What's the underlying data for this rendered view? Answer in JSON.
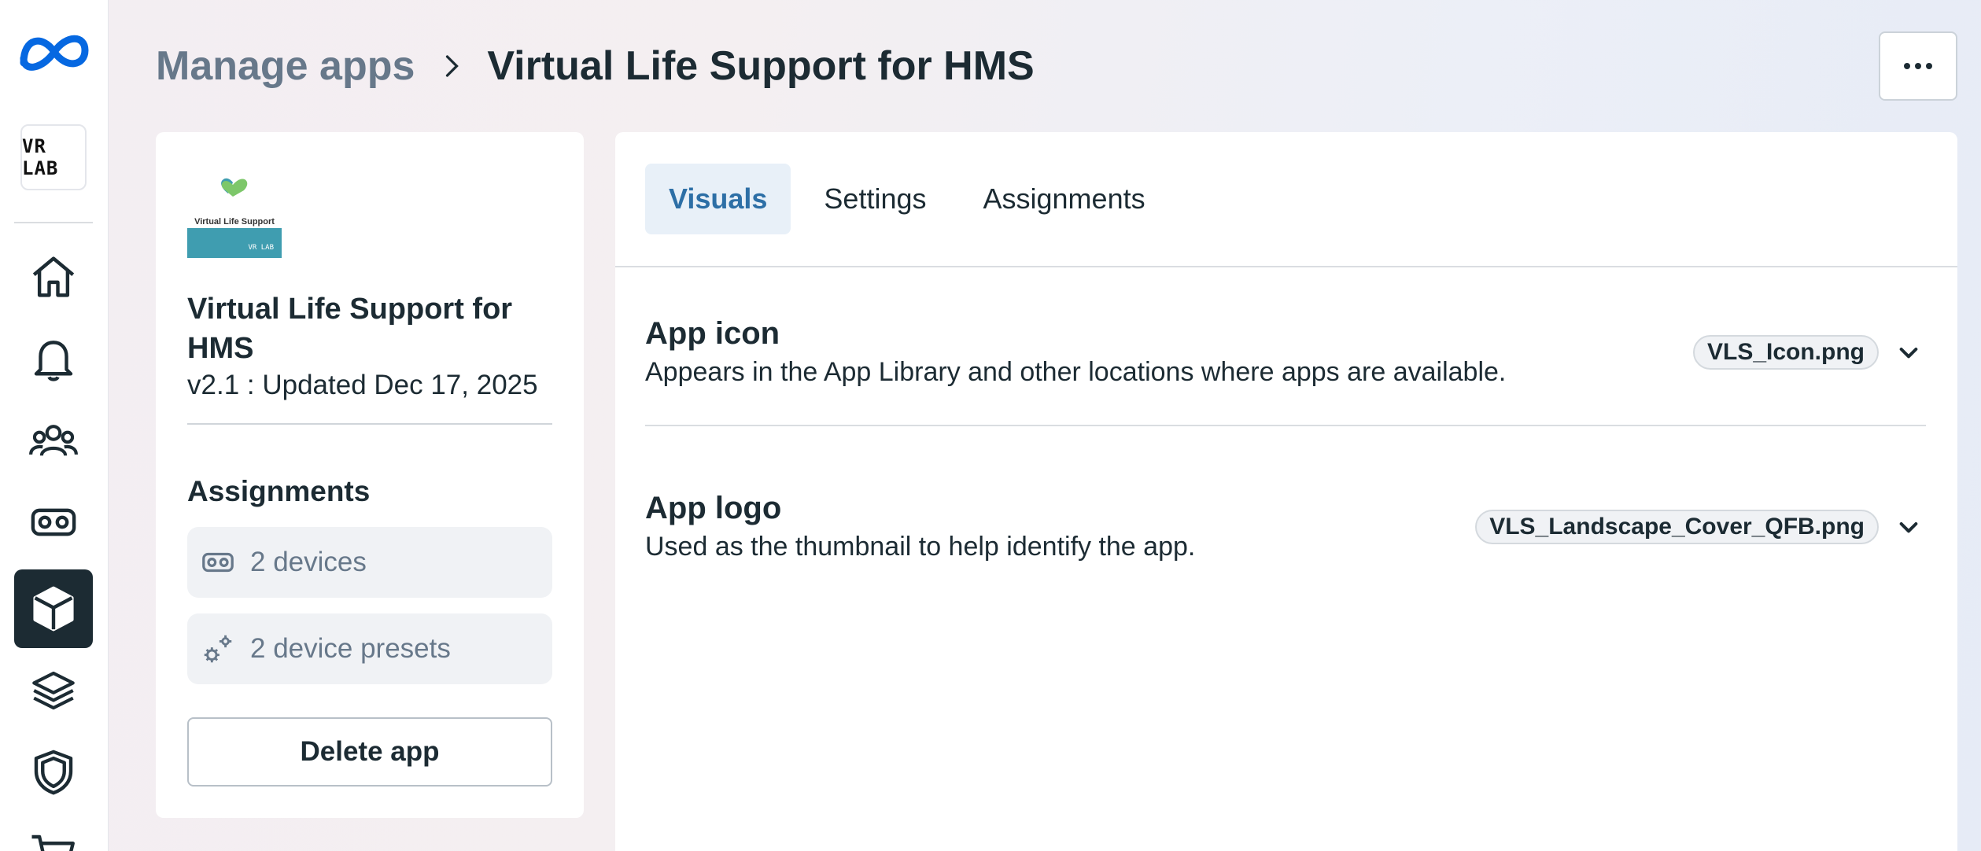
{
  "org": {
    "label": "VR LAB"
  },
  "breadcrumb": {
    "parent": "Manage apps",
    "current": "Virtual Life Support for HMS"
  },
  "header": {
    "more_label": "..."
  },
  "sidebar": {
    "items": [
      {
        "name": "home",
        "icon": "home-icon",
        "active": false
      },
      {
        "name": "notifications",
        "icon": "bell-icon",
        "active": false
      },
      {
        "name": "people",
        "icon": "people-icon",
        "active": false
      },
      {
        "name": "devices",
        "icon": "vr-headset-icon",
        "active": false
      },
      {
        "name": "apps",
        "icon": "cube-icon",
        "active": true
      },
      {
        "name": "layers",
        "icon": "layers-icon",
        "active": false
      },
      {
        "name": "security",
        "icon": "shield-icon",
        "active": false
      },
      {
        "name": "store",
        "icon": "cart-icon",
        "active": false
      }
    ]
  },
  "app": {
    "thumbnail_title": "Virtual Life Support",
    "thumbnail_badge": "VR LAB",
    "name": "Virtual Life Support for HMS",
    "version": "v2.1 : Updated Dec 17, 2025"
  },
  "assignments": {
    "heading": "Assignments",
    "devices": "2 devices",
    "presets": "2 device presets"
  },
  "actions": {
    "delete_label": "Delete app"
  },
  "tabs": [
    {
      "label": "Visuals",
      "active": true
    },
    {
      "label": "Settings",
      "active": false
    },
    {
      "label": "Assignments",
      "active": false
    }
  ],
  "visuals": {
    "icon": {
      "title": "App icon",
      "description": "Appears in the App Library and other locations where apps are available.",
      "file": "VLS_Icon.png"
    },
    "logo": {
      "title": "App logo",
      "description": "Used as the thumbnail to help identify the app.",
      "file": "VLS_Landscape_Cover_QFB.png"
    }
  },
  "colors": {
    "accent": "#2d6fa6",
    "active_rail": "#1c2b33",
    "meta_blue": "#0668e1"
  }
}
